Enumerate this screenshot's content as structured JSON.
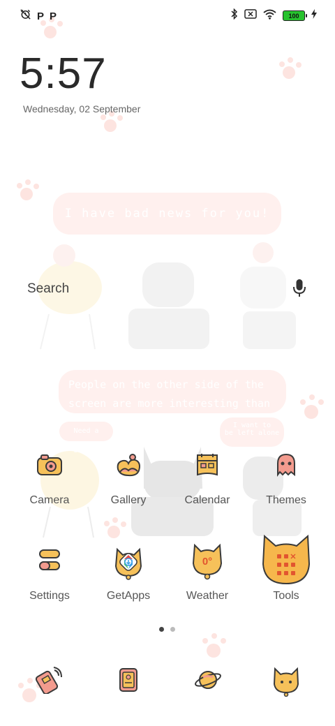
{
  "status_bar": {
    "left_icons": [
      "alarm-off-icon",
      "p-notification-icon",
      "p-notification-icon"
    ],
    "left_letters": [
      "P",
      "P"
    ],
    "right_icons": [
      "bluetooth-icon",
      "no-sim-icon",
      "wifi-icon",
      "battery-icon",
      "charging-icon"
    ],
    "battery_level": "100"
  },
  "clock": {
    "time": "5:57",
    "date": "Wednesday, 02 September"
  },
  "wallpaper": {
    "bubble_top": "I have bad news for you!",
    "bubble_mid_line1": "People on the other side of the",
    "bubble_mid_line2": "screen are more interesting than us",
    "bubble_small_left": "Need a break?",
    "bubble_small_right_1": "I want to",
    "bubble_small_right_2": "be left alone",
    "colors": {
      "bubble": "#fff0ee",
      "paw": "#fde0dc",
      "cat": "#ebebeb"
    }
  },
  "search": {
    "label": "Search",
    "mic_icon": "microphone-icon"
  },
  "apps": {
    "row1": [
      {
        "label": "Camera",
        "icon": "camera-icon"
      },
      {
        "label": "Gallery",
        "icon": "gallery-icon"
      },
      {
        "label": "Calendar",
        "icon": "calendar-icon"
      },
      {
        "label": "Themes",
        "icon": "themes-icon"
      }
    ],
    "row2": [
      {
        "label": "Settings",
        "icon": "settings-icon"
      },
      {
        "label": "GetApps",
        "icon": "getapps-icon"
      },
      {
        "label": "Weather",
        "icon": "weather-icon",
        "icon_text": "0°"
      },
      {
        "label": "Tools",
        "icon": "tools-folder-icon"
      }
    ]
  },
  "page_indicator": {
    "total": 2,
    "current": 1
  },
  "dock": [
    {
      "icon": "phone-icon"
    },
    {
      "icon": "contacts-icon"
    },
    {
      "icon": "browser-planet-icon"
    },
    {
      "icon": "cat-app-icon"
    }
  ],
  "colors": {
    "accent": "#f4b04f",
    "icon_fill": "#f6c15a",
    "icon_pink": "#f39b8e",
    "icon_stroke": "#3a3a3a"
  }
}
